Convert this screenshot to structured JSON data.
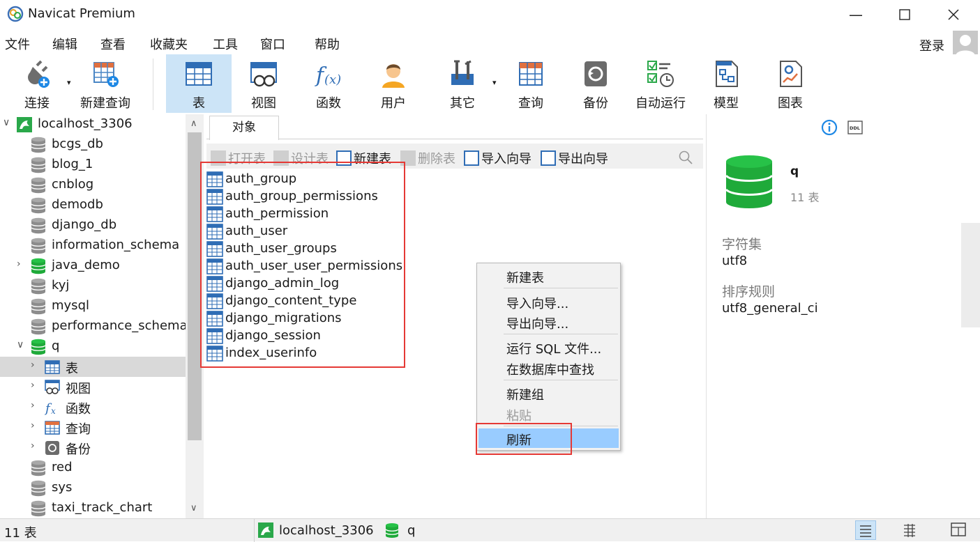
{
  "window": {
    "title": "Navicat Premium"
  },
  "menubar": {
    "items": [
      "文件",
      "编辑",
      "查看",
      "收藏夹",
      "工具",
      "窗口",
      "帮助"
    ],
    "login": "登录"
  },
  "toolbar": {
    "connect": "连接",
    "new_query": "新建查询",
    "table": "表",
    "view": "视图",
    "function": "函数",
    "user": "用户",
    "other": "其它",
    "query": "查询",
    "backup": "备份",
    "auto_run": "自动运行",
    "model": "模型",
    "chart": "图表"
  },
  "sidebar": {
    "connection": "localhost_3306",
    "databases": [
      "bcgs_db",
      "blog_1",
      "cnblog",
      "demodb",
      "django_db",
      "information_schema",
      "java_demo",
      "kyj",
      "mysql",
      "performance_schema",
      "q"
    ],
    "q_children": [
      "表",
      "视图",
      "函数",
      "查询",
      "备份"
    ],
    "after": [
      "red",
      "sys",
      "taxi_track_chart"
    ]
  },
  "center": {
    "tab": "对象",
    "object_toolbar": {
      "open": "打开表",
      "design": "设计表",
      "new": "新建表",
      "delete": "删除表",
      "import": "导入向导",
      "export": "导出向导"
    },
    "tables": [
      "auth_group",
      "auth_group_permissions",
      "auth_permission",
      "auth_user",
      "auth_user_groups",
      "auth_user_user_permissions",
      "django_admin_log",
      "django_content_type",
      "django_migrations",
      "django_session",
      "index_userinfo"
    ]
  },
  "context_menu": {
    "new_table": "新建表",
    "import_wizard": "导入向导...",
    "export_wizard": "导出向导...",
    "run_sql": "运行 SQL 文件...",
    "find_in_db": "在数据库中查找",
    "new_group": "新建组",
    "paste": "粘贴",
    "refresh": "刷新"
  },
  "right_panel": {
    "db_name": "q",
    "table_count": "11 表",
    "charset_label": "字符集",
    "charset": "utf8",
    "collation_label": "排序规则",
    "collation": "utf8_general_ci"
  },
  "status": {
    "count": "11 表",
    "connection": "localhost_3306",
    "database": "q"
  },
  "colors": {
    "accent": "#1e88e5",
    "db_green": "#1faa3a",
    "highlight": "#99ccff",
    "red_box": "#e53935",
    "selected_tool": "#cce4f7"
  }
}
